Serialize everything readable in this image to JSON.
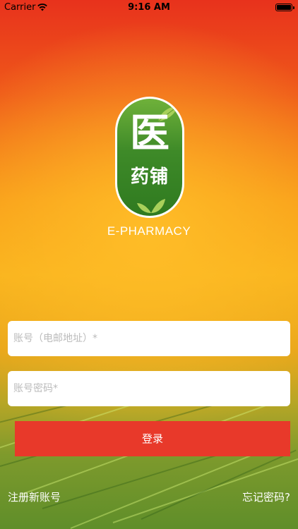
{
  "status_bar": {
    "carrier": "Carrier",
    "time": "9:16 AM"
  },
  "logo": {
    "main_char": "医",
    "sub_text": "药铺",
    "brand": "E-PHARMACY"
  },
  "form": {
    "account_placeholder": "账号（电邮地址）*",
    "password_placeholder": "账号密码*",
    "login_label": "登录"
  },
  "links": {
    "register": "注册新账号",
    "forgot": "忘记密码?"
  },
  "colors": {
    "login_button": "#e8392a",
    "logo_green": "#3e8a28"
  }
}
